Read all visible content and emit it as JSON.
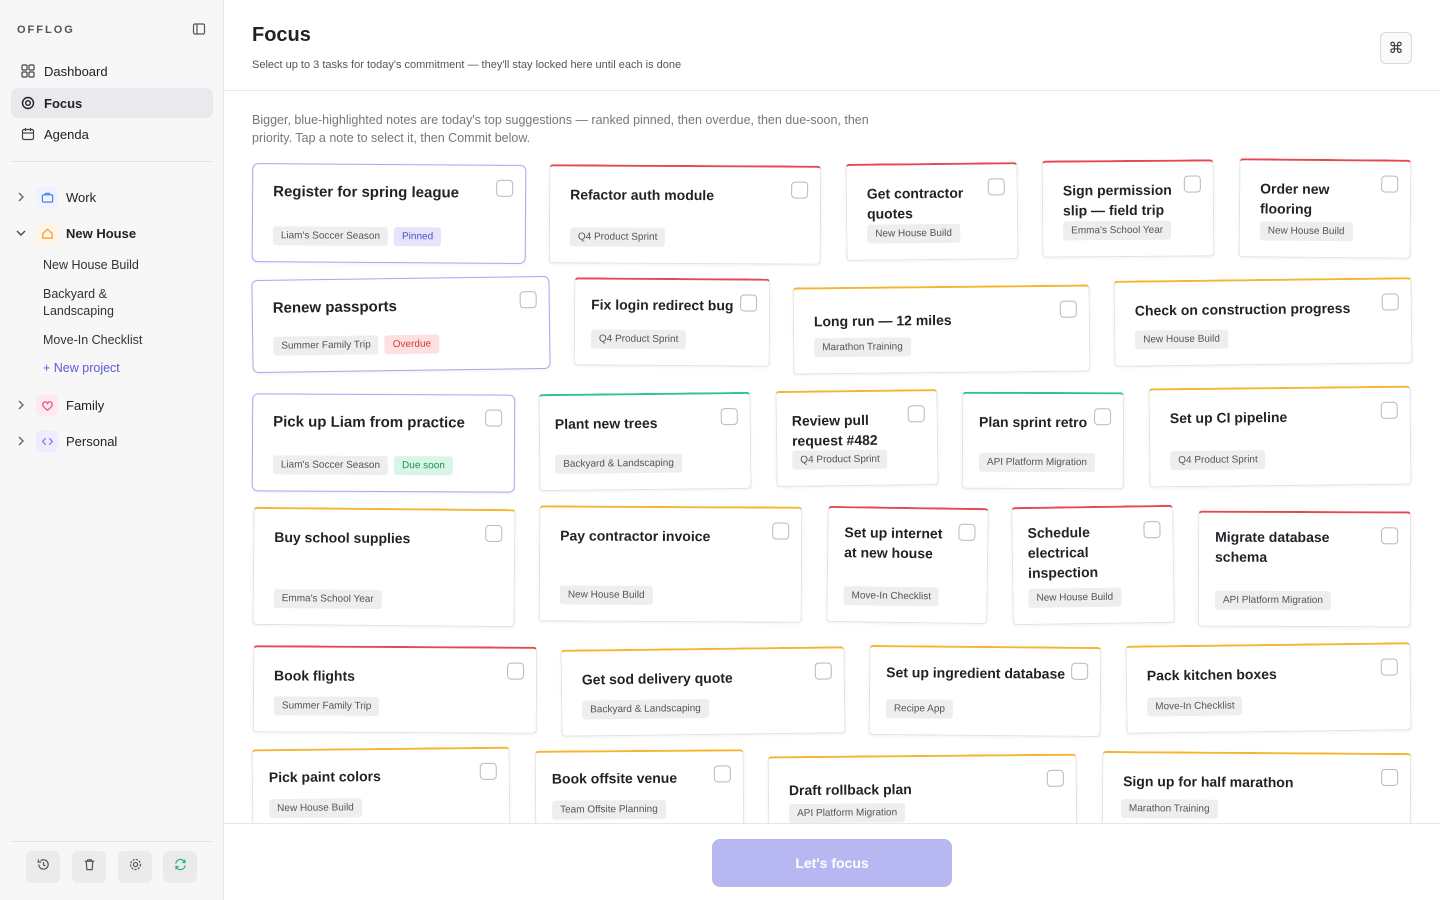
{
  "app": {
    "brand": "OFFLOG"
  },
  "sidebar": {
    "nav": [
      {
        "label": "Dashboard",
        "icon": "grid-icon"
      },
      {
        "label": "Focus",
        "icon": "target-icon"
      },
      {
        "label": "Agenda",
        "icon": "calendar-icon"
      }
    ],
    "areas": [
      {
        "label": "Work",
        "icon": "briefcase-icon",
        "color": "#eef3ff"
      },
      {
        "label": "New House",
        "icon": "home-icon",
        "color": "#fff4e5"
      },
      {
        "label": "Family",
        "icon": "heart-icon",
        "color": "#ffe8ef"
      },
      {
        "label": "Personal",
        "icon": "code-icon",
        "color": "#f0ecff"
      }
    ],
    "projects": [
      "New House Build",
      "Backyard & Landscaping",
      "Move-In Checklist"
    ],
    "new_project": "+ New project"
  },
  "header": {
    "title": "Focus",
    "subtitle": "Select up to 3 tasks for today's commitment — they'll stay locked here until each is done",
    "shortcut": "⌘"
  },
  "hint": "Bigger, blue-highlighted notes are today's top suggestions — ranked pinned, then overdue, then due-soon, then priority. Tap a note to select it, then Commit below.",
  "cards": [
    {
      "title": "Register for spring league",
      "tag": "Liam's Soccer Season",
      "badge": "Pinned"
    },
    {
      "title": "Refactor auth module",
      "tag": "Q4 Product Sprint"
    },
    {
      "title": "Get contractor quotes",
      "tag": "New House Build"
    },
    {
      "title": "Sign permission slip — field trip",
      "tag": "Emma's School Year"
    },
    {
      "title": "Order new flooring",
      "tag": "New House Build"
    },
    {
      "title": "Renew passports",
      "tag": "Summer Family Trip",
      "badge": "Overdue"
    },
    {
      "title": "Fix login redirect bug",
      "tag": "Q4 Product Sprint"
    },
    {
      "title": "Long run — 12 miles",
      "tag": "Marathon Training"
    },
    {
      "title": "Check on construction progress",
      "tag": "New House Build"
    },
    {
      "title": "Pick up Liam from practice",
      "tag": "Liam's Soccer Season",
      "badge": "Due soon"
    },
    {
      "title": "Plant new trees",
      "tag": "Backyard & Landscaping"
    },
    {
      "title": "Review pull request #482",
      "tag": "Q4 Product Sprint"
    },
    {
      "title": "Plan sprint retro",
      "tag": "API Platform Migration"
    },
    {
      "title": "Set up CI pipeline",
      "tag": "Q4 Product Sprint"
    },
    {
      "title": "Buy school supplies",
      "tag": "Emma's School Year"
    },
    {
      "title": "Pay contractor invoice",
      "tag": "New House Build"
    },
    {
      "title": "Set up internet at new house",
      "tag": "Move-In Checklist"
    },
    {
      "title": "Schedule electrical inspection",
      "tag": "New House Build"
    },
    {
      "title": "Migrate database schema",
      "tag": "API Platform Migration"
    },
    {
      "title": "Book flights",
      "tag": "Summer Family Trip"
    },
    {
      "title": "Get sod delivery quote",
      "tag": "Backyard & Landscaping"
    },
    {
      "title": "Set up ingredient database",
      "tag": "Recipe App"
    },
    {
      "title": "Pack kitchen boxes",
      "tag": "Move-In Checklist"
    },
    {
      "title": "Pick paint colors",
      "tag": "New House Build"
    },
    {
      "title": "Book offsite venue",
      "tag": "Team Offsite Planning"
    },
    {
      "title": "Draft rollback plan",
      "tag": "API Platform Migration"
    },
    {
      "title": "Sign up for half marathon",
      "tag": "Marathon Training"
    }
  ],
  "footer": {
    "cta": "Let's focus"
  },
  "colors": {
    "accent": "#5b5bd6",
    "red": "#e5484d",
    "amber": "#f5b52e",
    "green": "#30c48d"
  }
}
